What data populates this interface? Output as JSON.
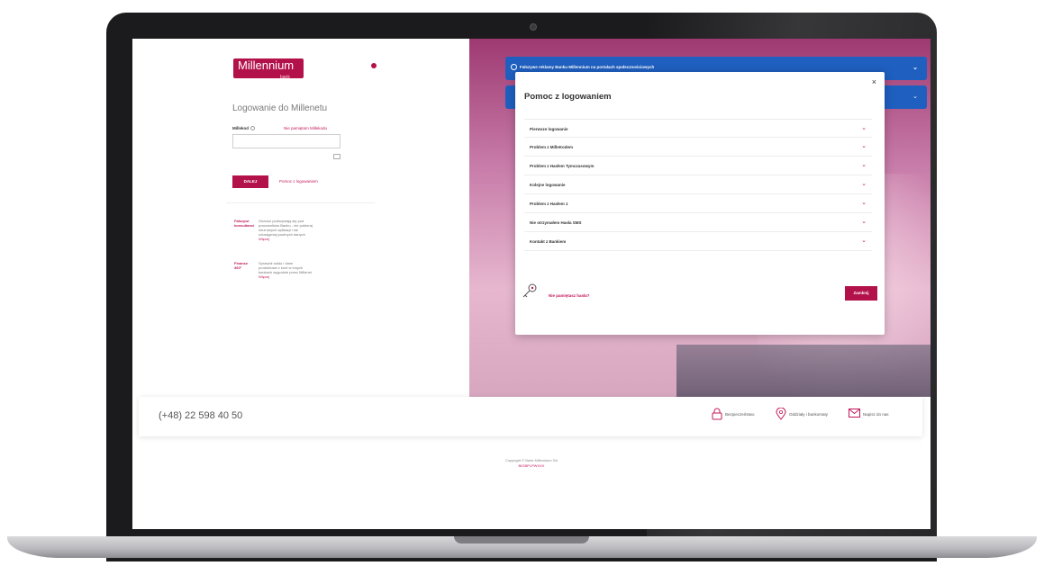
{
  "colors": {
    "brand": "#b3114a",
    "link": "#c2185b",
    "alert": "#1f5fbf"
  },
  "login": {
    "logo_text": "Millennium",
    "logo_sub": "bank",
    "title": "Logowanie do Millenetu",
    "millekod_label": "Millekod",
    "forgot_millekod": "Nie pamiętam Millekodu",
    "next_button": "DALEJ",
    "help_link": "Pomoc z logowaniem"
  },
  "tips": [
    {
      "title": "Fałszywi konsultanci",
      "text": "Oszuści podszywają się pod pracowników Banku - nie pobieraj nieznanych aplikacji i nie udostępniaj poufnych danych",
      "more": "Więcej"
    },
    {
      "title": "Finanse 360°",
      "text": "Sprawdź saldo i dane produktowe z kont w innych bankach wygodnie przez Millenet",
      "more": "Więcej"
    }
  ],
  "alerts": [
    {
      "text": "Fałszywe reklamy Banku Millennium na portalach społecznościowych"
    }
  ],
  "modal": {
    "title": "Pomoc z logowaniem",
    "close_symbol": "×",
    "items": [
      "Pierwsze logowanie",
      "Problem z MilleKodem",
      "Problem z Hasłem Tymczasowym",
      "Kolejne logowanie",
      "Problem z Hasłem 1",
      "Nie otrzymałem Hasła SMS",
      "Kontakt z Bankiem"
    ],
    "forgot_password": "Nie pamiętasz hasła?",
    "close_button": "Zamknij"
  },
  "footer": {
    "phone": "(+48) 22 598 40 50",
    "links": [
      "Bezpieczeństwo",
      "Oddziały i bankomaty",
      "Napisz do nas"
    ],
    "copyright": "Copyright © Bank Millennium SA",
    "swift": "BIGBPLPWXXX"
  }
}
